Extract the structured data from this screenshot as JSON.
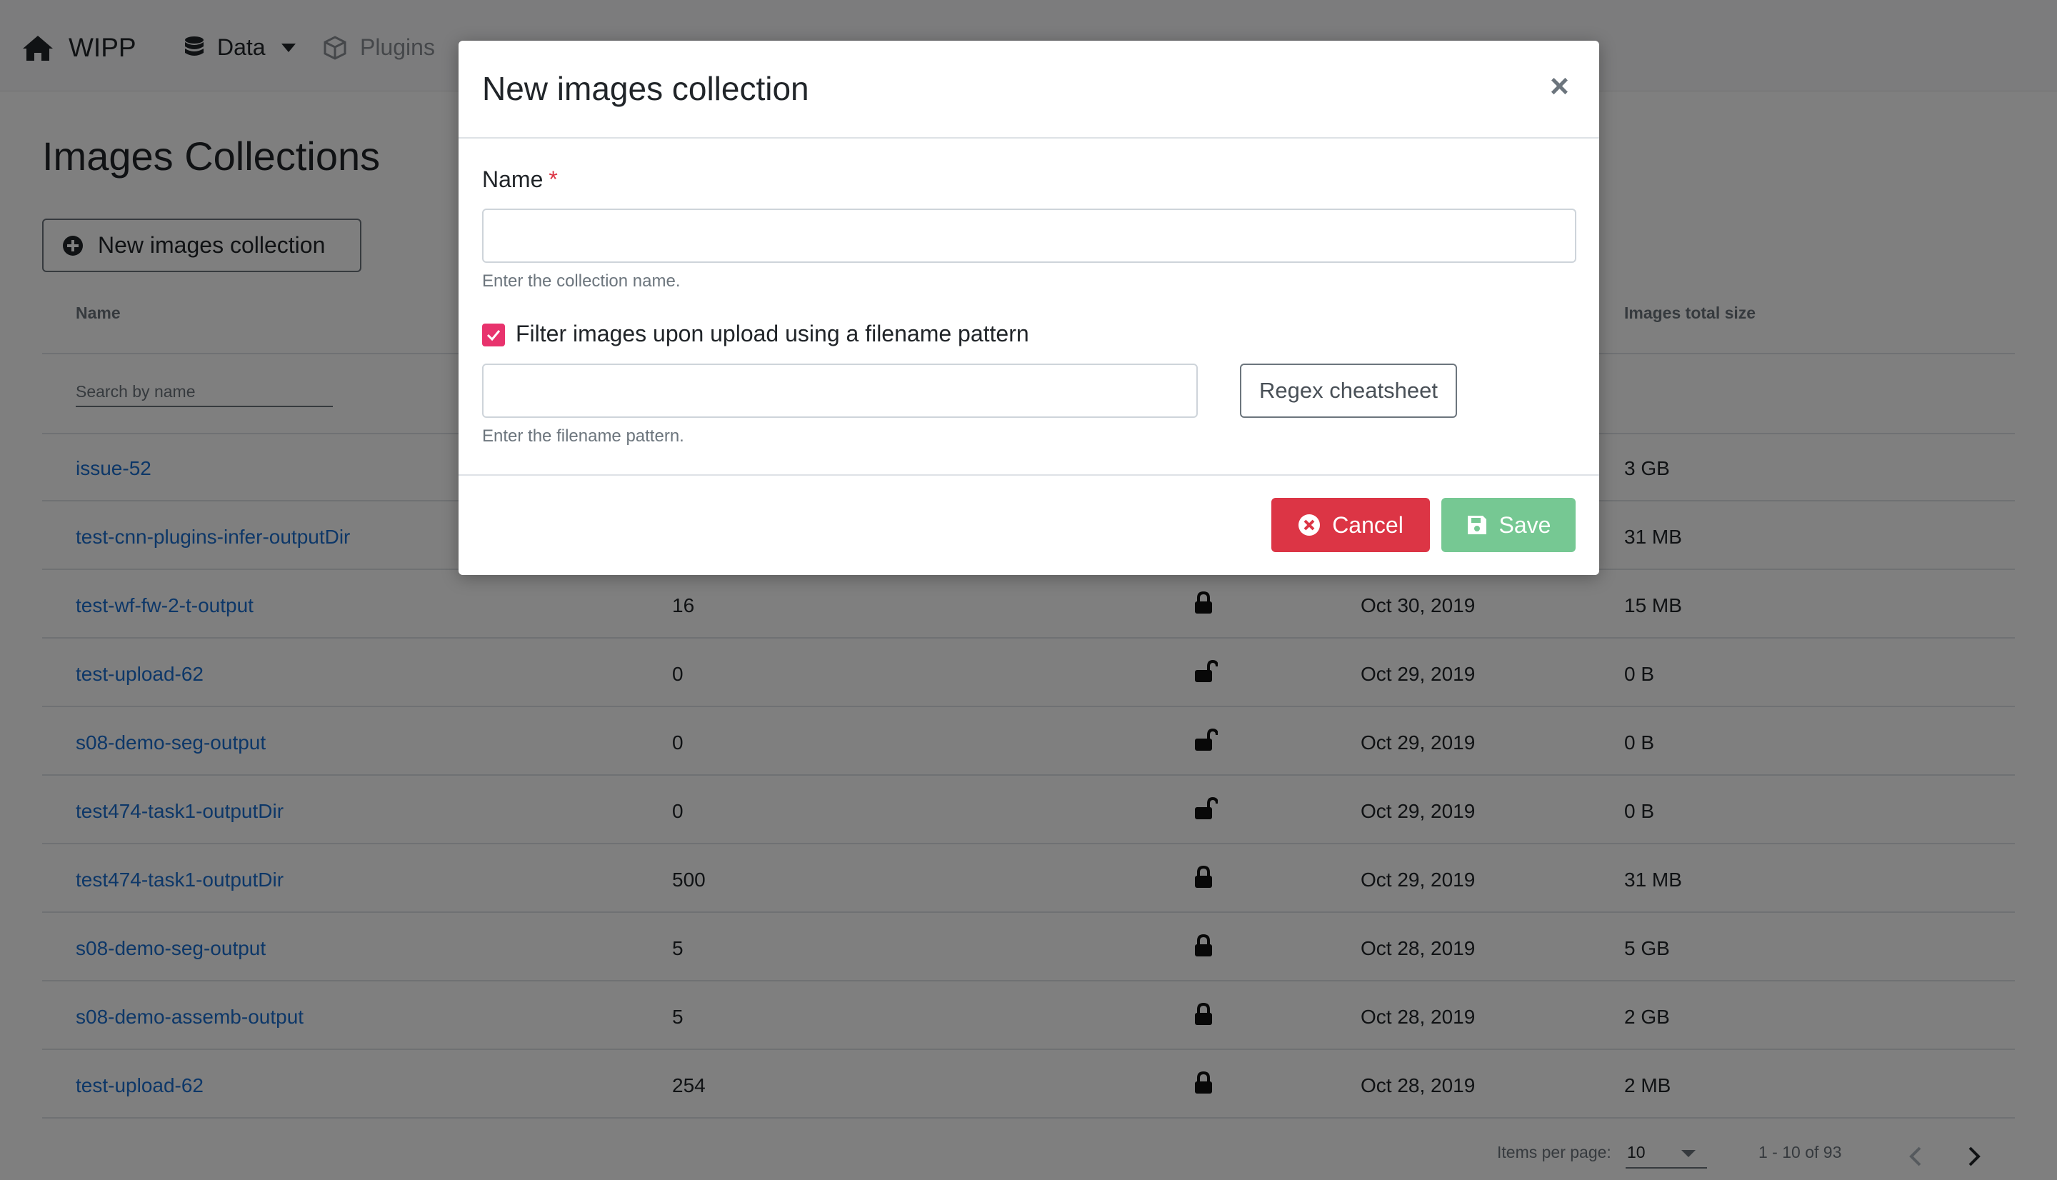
{
  "navbar": {
    "brand": "WIPP",
    "items": [
      {
        "label": "Data",
        "icon": "database-icon"
      },
      {
        "label": "Plugins",
        "icon": "cube-icon"
      }
    ]
  },
  "page": {
    "title": "Images Collections",
    "new_button": "New images collection"
  },
  "table": {
    "columns": {
      "name": "Name",
      "size": "Images total size"
    },
    "search_placeholder": "Search by name",
    "rows": [
      {
        "name": "issue-52",
        "count": "",
        "lock": "",
        "date": "",
        "size": "3 GB"
      },
      {
        "name": "test-cnn-plugins-infer-outputDir",
        "count": "",
        "lock": "",
        "date": "",
        "size": "31 MB"
      },
      {
        "name": "test-wf-fw-2-t-output",
        "count": "16",
        "lock": "locked",
        "date": "Oct 30, 2019",
        "size": "15 MB"
      },
      {
        "name": "test-upload-62",
        "count": "0",
        "lock": "unlocked",
        "date": "Oct 29, 2019",
        "size": "0 B"
      },
      {
        "name": "s08-demo-seg-output",
        "count": "0",
        "lock": "unlocked",
        "date": "Oct 29, 2019",
        "size": "0 B"
      },
      {
        "name": "test474-task1-outputDir",
        "count": "0",
        "lock": "unlocked",
        "date": "Oct 29, 2019",
        "size": "0 B"
      },
      {
        "name": "test474-task1-outputDir",
        "count": "500",
        "lock": "locked",
        "date": "Oct 29, 2019",
        "size": "31 MB"
      },
      {
        "name": "s08-demo-seg-output",
        "count": "5",
        "lock": "locked",
        "date": "Oct 28, 2019",
        "size": "5 GB"
      },
      {
        "name": "s08-demo-assemb-output",
        "count": "5",
        "lock": "locked",
        "date": "Oct 28, 2019",
        "size": "2 GB"
      },
      {
        "name": "test-upload-62",
        "count": "254",
        "lock": "locked",
        "date": "Oct 28, 2019",
        "size": "2 MB"
      }
    ]
  },
  "paginator": {
    "items_per_page_label": "Items per page:",
    "items_per_page": "10",
    "range": "1 - 10 of 93"
  },
  "modal": {
    "title": "New images collection",
    "close": "×",
    "name_label": "Name",
    "required_mark": "*",
    "name_value": "",
    "name_help": "Enter the collection name.",
    "filter_checked": true,
    "filter_label": "Filter images upon upload using a filename pattern",
    "pattern_value": "",
    "pattern_help": "Enter the filename pattern.",
    "regex_button": "Regex cheatsheet",
    "cancel": "Cancel",
    "save": "Save"
  },
  "colors": {
    "link": "#1a6fd0",
    "cancel": "#dc3545",
    "save": "#76c893",
    "checkbox": "#e8336d"
  }
}
